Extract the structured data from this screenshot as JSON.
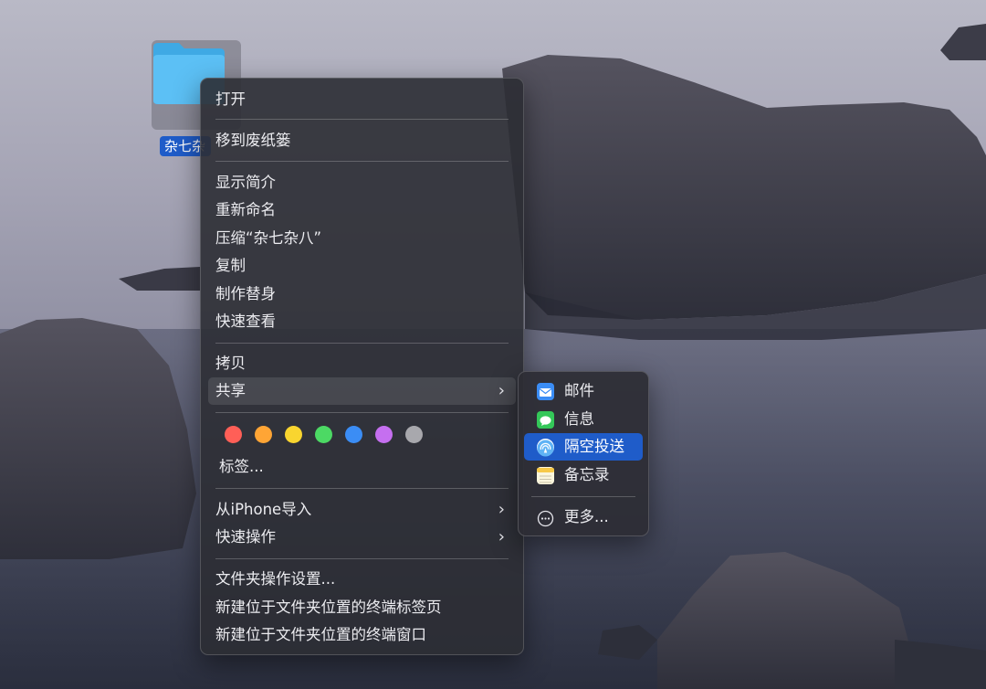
{
  "desktop": {
    "folder": {
      "name": "杂七杂八",
      "label_visible": "杂七杂"
    }
  },
  "context_menu": {
    "items": {
      "open": "打开",
      "move_to_trash": "移到废纸篓",
      "get_info": "显示简介",
      "rename": "重新命名",
      "compress": "压缩“杂七杂八”",
      "duplicate": "复制",
      "make_alias": "制作替身",
      "quick_look": "快速查看",
      "copy": "拷贝",
      "share": "共享",
      "tags": "标签...",
      "import_from_iphone": "从iPhone导入",
      "quick_actions": "快速操作",
      "folder_actions_setup": "文件夹操作设置...",
      "new_terminal_tab": "新建位于文件夹位置的终端标签页",
      "new_terminal_window": "新建位于文件夹位置的终端窗口"
    },
    "chevron": "›",
    "tag_colors": [
      {
        "name": "red",
        "color": "#ff5f57"
      },
      {
        "name": "orange",
        "color": "#ffa535"
      },
      {
        "name": "yellow",
        "color": "#f9d52f"
      },
      {
        "name": "green",
        "color": "#4cd964"
      },
      {
        "name": "blue",
        "color": "#3b8df5"
      },
      {
        "name": "purple",
        "color": "#c56ff0"
      },
      {
        "name": "gray",
        "color": "#a8a8ad"
      }
    ]
  },
  "share_submenu": {
    "items": {
      "mail": "邮件",
      "messages": "信息",
      "airdrop": "隔空投送",
      "notes": "备忘录",
      "more": "更多..."
    },
    "selected": "airdrop"
  },
  "colors": {
    "selection": "#1f5cc9",
    "folder": "#5cc0f5"
  }
}
